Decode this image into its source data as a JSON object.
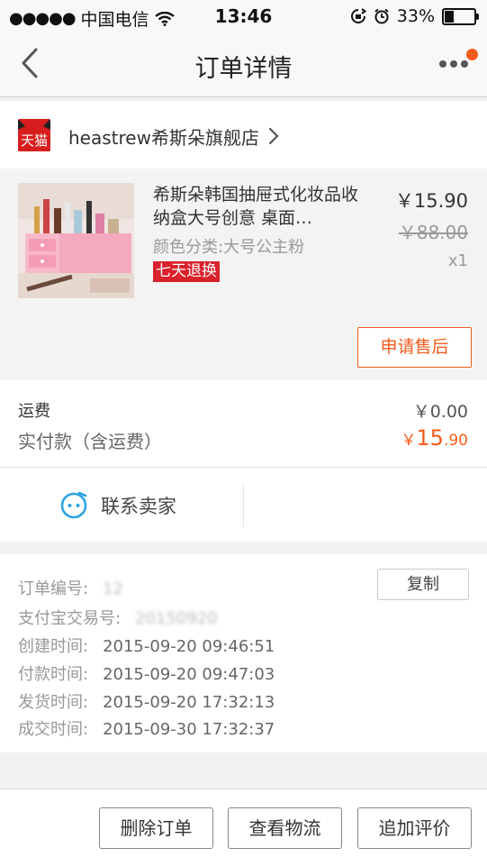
{
  "status_bar": {
    "signal": "●●●●●",
    "carrier": "中国电信",
    "time": "13:46",
    "battery_text": "33%",
    "battery_level": 0.33
  },
  "nav": {
    "title": "订单详情",
    "notify_color": "#f25b1b"
  },
  "store": {
    "logo_text": "天猫",
    "name": "heastrew希斯朵旗舰店"
  },
  "product": {
    "title": "希斯朵韩国抽屉式化妆品收纳盒大号创意 桌面…",
    "spec": "颜色分类:大号公主粉",
    "badge": "七天退换",
    "price": "￥15.90",
    "original_price": "￥88.00",
    "quantity": "x1",
    "aftersale_label": "申请售后"
  },
  "costs": {
    "shipping_label": "运费",
    "shipping_value": "￥0.00",
    "paid_label": "实付款（含运费）",
    "paid_symbol": "￥",
    "paid_int": "15",
    "paid_dec": ".90"
  },
  "contact": {
    "label": "联系卖家"
  },
  "order_info": {
    "order_no_label": "订单编号:",
    "order_no_value": "12",
    "copy_label": "复制",
    "alipay_label": "支付宝交易号:",
    "alipay_value": "20150920",
    "created_label": "创建时间:",
    "created_value": "2015-09-20 09:46:51",
    "paid_time_label": "付款时间:",
    "paid_time_value": "2015-09-20 09:47:03",
    "shipped_label": "发货时间:",
    "shipped_value": "2015-09-20 17:32:13",
    "done_label": "成交时间:",
    "done_value": "2015-09-30 17:32:37"
  },
  "actions": {
    "delete": "删除订单",
    "logistics": "查看物流",
    "review": "追加评价"
  },
  "colors": {
    "accent": "#f25b1b",
    "badge_red": "#d9212b",
    "tmall_red": "#d71d1d"
  }
}
